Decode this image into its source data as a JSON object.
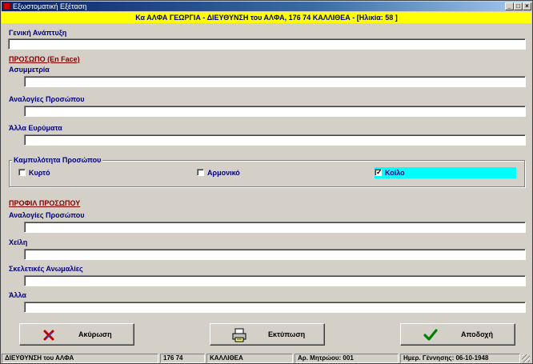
{
  "window": {
    "title": "Εξωστοματική Εξέταση"
  },
  "banner": {
    "text": "Κα ΑΛΦΑ ΓΕΩΡΓΙΑ - ΔΙΕΥΘΥΝΣΗ του ΑΛΦΑ, 176 74 ΚΑΛΛΙΘΕΑ - [Ηλικία: 58 ]"
  },
  "general": {
    "label": "Γενική Ανάπτυξη",
    "value": ""
  },
  "face": {
    "section_title": "ΠΡΟΣΩΠΟ (En Face)",
    "asymmetry": {
      "label": "Ασυμμετρία",
      "value": ""
    },
    "proportions": {
      "label": "Αναλογίες Προσώπου",
      "value": ""
    },
    "other": {
      "label": "Άλλα Ευρύματα",
      "value": ""
    }
  },
  "curvature": {
    "title": "Καμπυλότητα Προσώπου",
    "options": [
      {
        "label": "Κυρτό",
        "checked": false
      },
      {
        "label": "Αρμονικό",
        "checked": false
      },
      {
        "label": "Κοίλο",
        "checked": true,
        "highlight": "#00ffff"
      }
    ]
  },
  "profile": {
    "section_title": "ΠΡΟΦΙΛ ΠΡΟΣΩΠΟΥ",
    "proportions": {
      "label": "Αναλογίες Προσώπου",
      "value": ""
    },
    "lips": {
      "label": "Χείλη",
      "value": ""
    },
    "skeletal": {
      "label": "Σκελετικές Ανωμαλίες",
      "value": ""
    },
    "other": {
      "label": "Άλλα",
      "value": ""
    }
  },
  "buttons": {
    "cancel": "Ακύρωση",
    "print": "Εκτύπωση",
    "accept": "Αποδοχή"
  },
  "status": {
    "address": "ΔΙΕΥΘΥΝΣΗ του ΑΛΦΑ",
    "zip": "176 74",
    "city": "ΚΑΛΛΙΘΕΑ",
    "registry": "Αρ. Μητρώου: 001",
    "birth": "Ημερ. Γέννησης: 06-10-1948"
  },
  "colors": {
    "title_bar": "#0a246a",
    "banner_bg": "#ffff00",
    "label": "#000080",
    "section": "#800000",
    "accent_highlight": "#00ffff"
  }
}
